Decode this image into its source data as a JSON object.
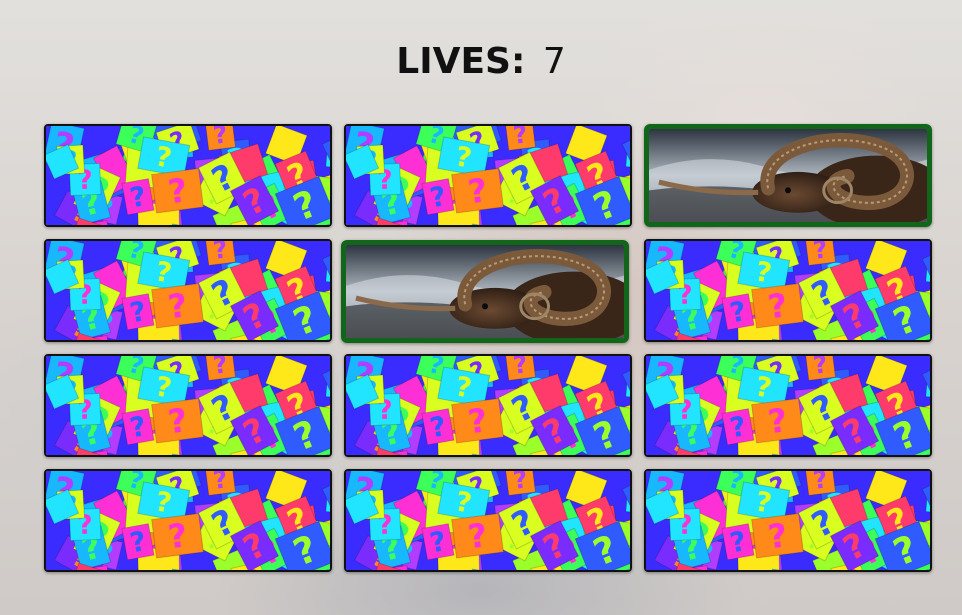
{
  "header": {
    "lives_label": "LIVES:",
    "lives_value": "7"
  },
  "colors": {
    "matched_border": "#11661a",
    "card_border": "#111111"
  },
  "cards": [
    {
      "state": "hidden",
      "icon": "question-mark-pattern"
    },
    {
      "state": "hidden",
      "icon": "question-mark-pattern"
    },
    {
      "state": "revealed",
      "icon": "ram-photo"
    },
    {
      "state": "hidden",
      "icon": "question-mark-pattern"
    },
    {
      "state": "revealed",
      "icon": "ram-photo"
    },
    {
      "state": "hidden",
      "icon": "question-mark-pattern"
    },
    {
      "state": "hidden",
      "icon": "question-mark-pattern"
    },
    {
      "state": "hidden",
      "icon": "question-mark-pattern"
    },
    {
      "state": "hidden",
      "icon": "question-mark-pattern"
    },
    {
      "state": "hidden",
      "icon": "question-mark-pattern"
    },
    {
      "state": "hidden",
      "icon": "question-mark-pattern"
    },
    {
      "state": "hidden",
      "icon": "question-mark-pattern"
    }
  ]
}
